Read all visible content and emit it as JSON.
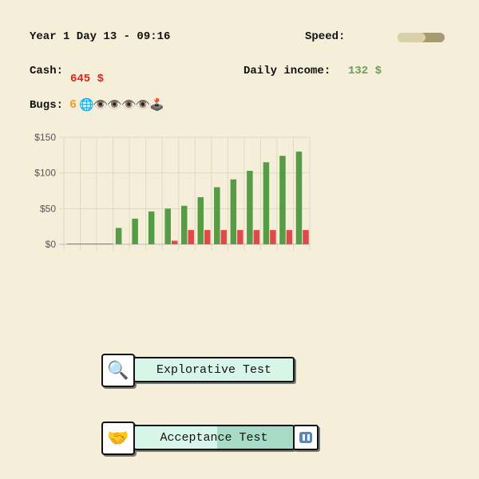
{
  "header": {
    "time": "Year 1 Day 13 - 09:16",
    "speed_label": "Speed:",
    "speed_level": 0.6
  },
  "stats": {
    "cash_label": "Cash:",
    "cash_value": "645 $",
    "income_label": "Daily income:",
    "income_value": "132 $",
    "bugs_label": "Bugs:",
    "bugs_count": "6",
    "bugs_icons": "🌐👁️👁️👁️👁️🕹️"
  },
  "chart_data": {
    "type": "bar",
    "ylim": [
      0,
      150
    ],
    "yticks": [
      0,
      50,
      100,
      150
    ],
    "ytick_labels": [
      "$0",
      "$50",
      "$100",
      "$150"
    ],
    "grid": true,
    "series": [
      {
        "color": "#559c45",
        "values": [
          0,
          0,
          0,
          23,
          36,
          46,
          50,
          54,
          66,
          80,
          91,
          103,
          115,
          124,
          130
        ]
      },
      {
        "color": "#e0494a",
        "values": [
          0,
          0,
          0,
          0,
          0,
          0,
          5,
          20,
          20,
          20,
          20,
          20,
          20,
          20,
          20
        ]
      }
    ]
  },
  "actions": [
    {
      "label": "Explorative Test",
      "icon": "🔍",
      "progress": 0,
      "has_pause": false
    },
    {
      "label": "Acceptance Test",
      "icon": "🤝",
      "progress": 0.48,
      "has_pause": true
    }
  ]
}
